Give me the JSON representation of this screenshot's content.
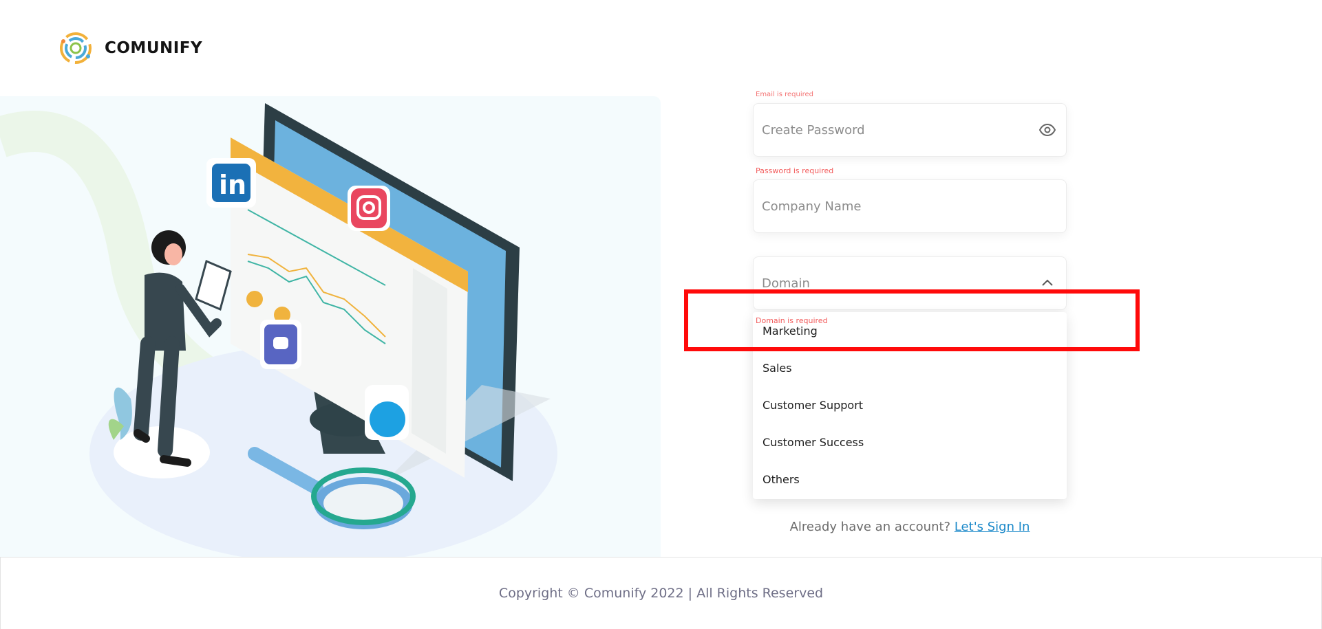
{
  "brand": {
    "name": "COMUNIFY"
  },
  "form": {
    "cut_error": "Email is required",
    "password": {
      "placeholder": "Create Password",
      "error": "Password is required"
    },
    "company": {
      "placeholder": "Company Name"
    },
    "domain": {
      "placeholder": "Domain",
      "error": "Domain is required",
      "options": [
        "Marketing",
        "Sales",
        "Customer Support",
        "Customer Success",
        "Others"
      ]
    }
  },
  "signin": {
    "prompt": "Already have an account?",
    "link": "Let's Sign In"
  },
  "footer": {
    "copyright": "Copyright © Comunify 2022 | All Rights Reserved"
  },
  "colors": {
    "error": "#f25a5a",
    "link": "#1a88c9",
    "highlight": "#ff0a0a"
  }
}
